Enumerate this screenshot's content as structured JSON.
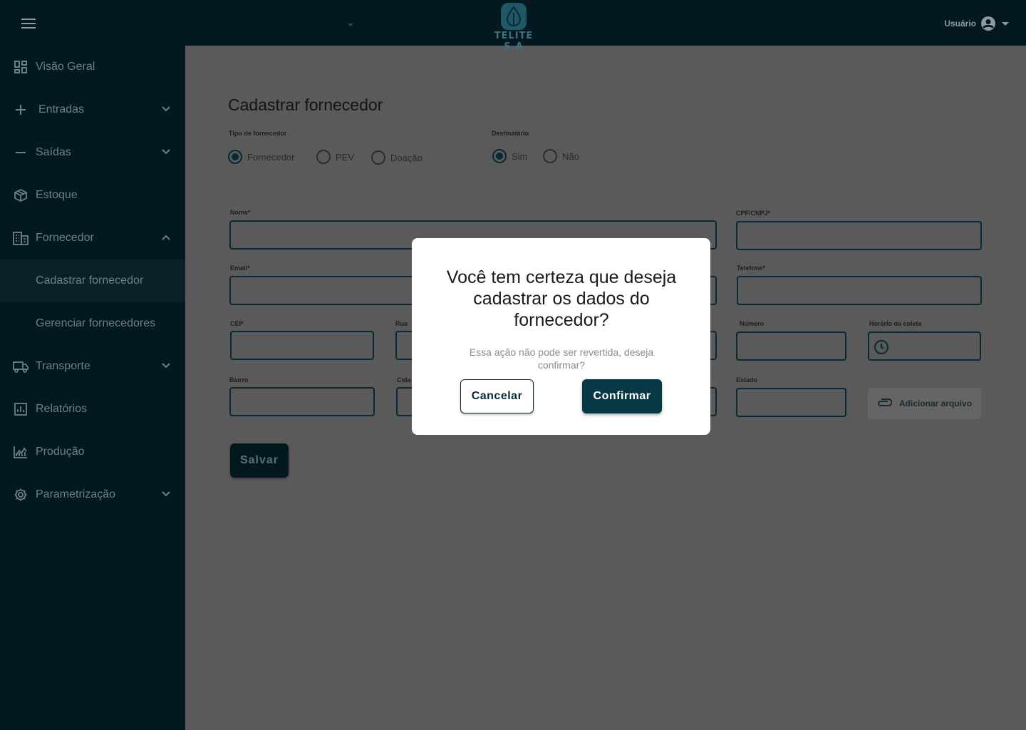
{
  "app": {
    "brand": "TELITE S.A"
  },
  "topbar": {
    "user_label": "Usuário"
  },
  "sidebar": {
    "items": [
      {
        "label": "Visão Geral",
        "icon": "dashboard-icon"
      },
      {
        "label": "Entradas",
        "icon": "plus-icon"
      },
      {
        "label": "Saídas",
        "icon": "minus-icon"
      },
      {
        "label": "Estoque",
        "icon": "box-icon"
      },
      {
        "label": "Fornecedor",
        "icon": "building-icon"
      },
      {
        "label": "Transporte",
        "icon": "truck-icon"
      },
      {
        "label": "Relatórios",
        "icon": "bar-chart-icon"
      },
      {
        "label": "Produção",
        "icon": "production-chart-icon"
      },
      {
        "label": "Parametrização",
        "icon": "gear-icon"
      }
    ],
    "subitems": [
      {
        "label": "Cadastrar fornecedor",
        "active": true
      },
      {
        "label": "Gerenciar fornecedores",
        "active": false
      }
    ]
  },
  "form": {
    "title": "Cadastrar fornecedor",
    "tipo": {
      "label": "Tipo de fornecedor",
      "options": [
        "Fornecedor",
        "PEV",
        "Doação"
      ],
      "selected": "Fornecedor"
    },
    "destinatario": {
      "label": "Destinatário",
      "options": [
        "Sim",
        "Não"
      ],
      "selected": "Sim"
    },
    "fields": {
      "nome": "Nome*",
      "cpf": "CPF/CNPJ*",
      "email": "Email*",
      "telefone": "Telefone*",
      "cep": "CEP",
      "rua": "Rua",
      "numero": "Número",
      "horario": "Horário da coleta",
      "bairro": "Bairro",
      "cidade": "Cida",
      "estado": "Estado"
    },
    "attach_label": "Adicionar arquivo",
    "save_label": "Salvar"
  },
  "modal": {
    "title": "Você tem certeza que deseja cadastrar os dados do fornecedor?",
    "text": "Essa ação não pode ser revertida, deseja confirmar?",
    "cancel_label": "Cancelar",
    "confirm_label": "Confirmar"
  },
  "colors": {
    "sidebar_bg": "#041820",
    "primary": "#073846",
    "overlay_bg": "#5a5a5a"
  }
}
